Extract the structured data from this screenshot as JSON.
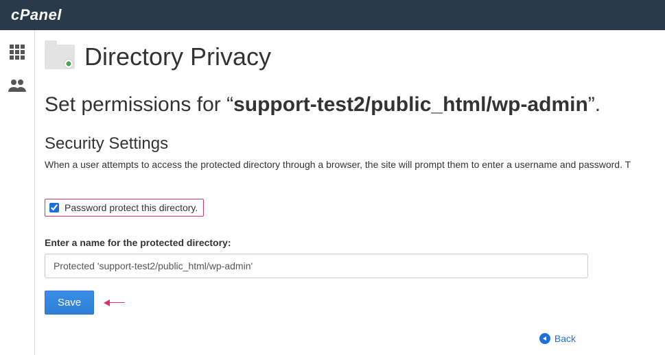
{
  "brand": "cPanel",
  "page": {
    "title": "Directory Privacy",
    "perm_prefix": "Set permissions for “",
    "perm_path": "support-test2/public_html/wp-admin",
    "perm_suffix": "”."
  },
  "security": {
    "heading": "Security Settings",
    "description": "When a user attempts to access the protected directory through a browser, the site will prompt them to enter a username and password. T",
    "checkbox_label": "Password protect this directory.",
    "checkbox_checked": true
  },
  "form": {
    "name_label": "Enter a name for the protected directory:",
    "name_value": "Protected 'support-test2/public_html/wp-admin'",
    "save_label": "Save"
  },
  "nav": {
    "back_label": "Back"
  },
  "annotations": {
    "highlight_checkbox": true,
    "arrow_to_save": true
  }
}
